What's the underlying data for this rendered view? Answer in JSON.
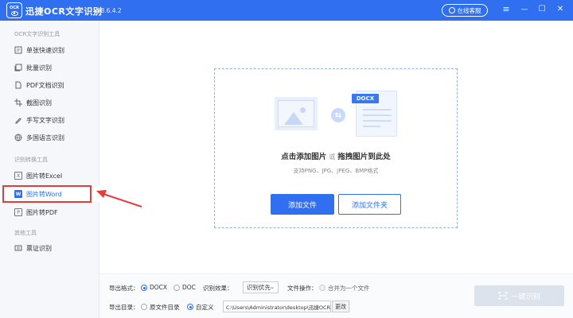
{
  "titlebar": {
    "logo_text": "OCR",
    "title": "迅捷OCR文字识别",
    "version": "v8.6.4.2",
    "service_label": "在线客服",
    "menu_icon": "≡",
    "minimize_icon": "—",
    "maximize_icon": "☐",
    "close_icon": "✕"
  },
  "sidebar": {
    "section1": "OCR文字识别工具",
    "section1_items": [
      {
        "label": "单张快速识别",
        "icon": "single-image-icon"
      },
      {
        "label": "批量识别",
        "icon": "batch-icon"
      },
      {
        "label": "PDF文档识别",
        "icon": "pdf-doc-icon"
      },
      {
        "label": "截图识别",
        "icon": "crop-icon"
      },
      {
        "label": "手写文字识别",
        "icon": "handwrite-icon"
      },
      {
        "label": "多国语言识别",
        "icon": "globe-icon"
      }
    ],
    "section2": "识别转换工具",
    "section2_items": [
      {
        "label": "图片转Excel",
        "icon_glyph": "X"
      },
      {
        "label": "图片转Word",
        "icon_glyph": "W"
      },
      {
        "label": "图片转PDF",
        "icon_glyph": "P"
      }
    ],
    "section3": "其他工具",
    "section3_items": [
      {
        "label": "票证识别",
        "icon": "ticket-icon"
      }
    ],
    "active_item": "图片转Word"
  },
  "dropzone": {
    "docx_tag": "DOCX",
    "title_click": "点击添加图片",
    "title_or": "或",
    "title_drag": "拖拽图片到此处",
    "supported": "支持PNG、JPG、JPEG、BMP格式",
    "add_file": "添加文件",
    "add_folder": "添加文件夹"
  },
  "bottombar": {
    "export_format_label": "导出格式：",
    "format_docx": "DOCX",
    "format_doc": "DOC",
    "selected_format": "DOCX",
    "recognition_effect_label": "识别效果：",
    "recognition_effect_value": "识别优先",
    "file_ops_label": "文件操作：",
    "merge_label": "合并为一个文件",
    "export_dir_label": "导出目录：",
    "dir_original": "原文件目录",
    "dir_custom": "自定义",
    "selected_dir": "自定义",
    "path_value": "C:\\Users\\Administrator\\desktop\\迅捷OCR",
    "change_label": "更改",
    "one_key_label": "一键识别"
  },
  "colors": {
    "primary": "#2f6ff0",
    "highlight_frame": "#e53b3b",
    "disabled_button": "#dde3ec"
  }
}
